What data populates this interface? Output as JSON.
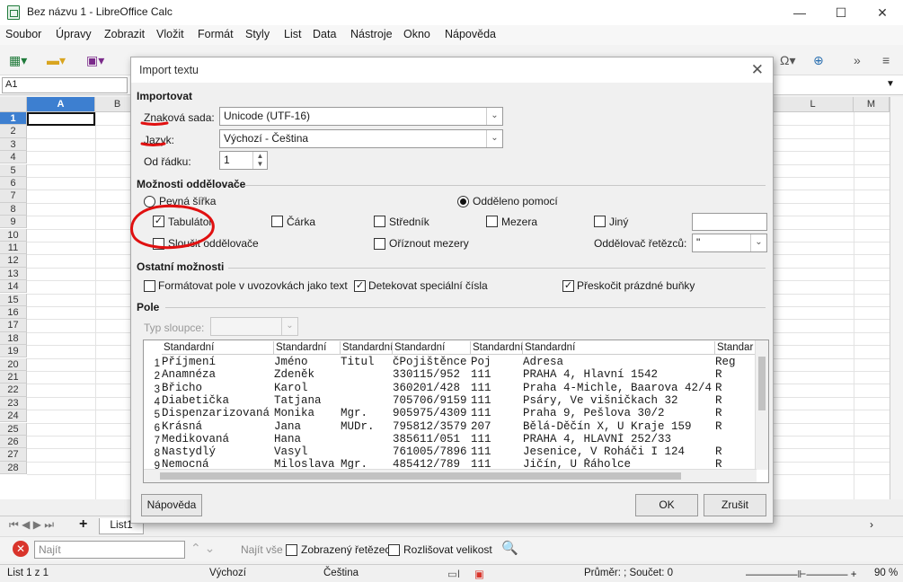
{
  "window": {
    "title": "Bez názvu 1 - LibreOffice Calc",
    "min": "—",
    "max": "☐",
    "close": "✕"
  },
  "menu": [
    "Soubor",
    "Úpravy",
    "Zobrazit",
    "Vložit",
    "Formát",
    "Styly",
    "List",
    "Data",
    "Nástroje",
    "Okno",
    "Nápověda"
  ],
  "formula": {
    "cell_ref": "A1"
  },
  "grid": {
    "columns": [
      "A",
      "B",
      "L",
      "M"
    ],
    "rows": [
      "1",
      "2",
      "3",
      "4",
      "5",
      "6",
      "7",
      "8",
      "9",
      "10",
      "11",
      "12",
      "13",
      "14",
      "15",
      "16",
      "17",
      "18",
      "19",
      "20",
      "21",
      "22",
      "23",
      "24",
      "25",
      "26",
      "27",
      "28"
    ]
  },
  "sheet": {
    "tab": "List1"
  },
  "find": {
    "placeholder": "Najít",
    "find_all": "Najít vše",
    "formatted": "Zobrazený řetězec",
    "match_case": "Rozlišovat velikost"
  },
  "status": {
    "sheet": "List 1 z 1",
    "style": "Výchozí",
    "lang": "Čeština",
    "sum": "Průměr: ; Součet: 0",
    "zoom": "90 %"
  },
  "dialog": {
    "title": "Import textu",
    "import_section": "Importovat",
    "charset_label": "Znaková sada:",
    "charset_value": "Unicode (UTF-16)",
    "lang_label": "Jazyk:",
    "lang_value": "Výchozí - Čeština",
    "row_label": "Od řádku:",
    "row_value": "1",
    "sep_section": "Možnosti oddělovače",
    "fixed_width": "Pevná šířka",
    "separated_by": "Odděleno pomocí",
    "tab": "Tabulátor",
    "comma": "Čárka",
    "semicolon": "Středník",
    "space": "Mezera",
    "other": "Jiný",
    "merge": "Sloučit oddělovače",
    "trim": "Oříznout mezery",
    "string_delim_label": "Oddělovač řetězců:",
    "string_delim_value": "\"",
    "other_section": "Ostatní možnosti",
    "quoted_as_text": "Formátovat pole v uvozovkách jako text",
    "detect_special": "Detekovat speciální čísla",
    "skip_empty": "Přeskočit prázdné buňky",
    "fields_section": "Pole",
    "col_type_label": "Typ sloupce:",
    "help": "Nápověda",
    "ok": "OK",
    "cancel": "Zrušit"
  },
  "preview": {
    "headers": [
      "Standardní",
      "Standardní",
      "Standardní",
      "Standardní",
      "Standardní",
      "Standardní",
      "Standar"
    ],
    "rows": [
      [
        "1",
        "Příjmení",
        "Jméno",
        "Titul",
        "čPojištěnce",
        "Poj",
        "Adresa",
        "Reg"
      ],
      [
        "2",
        "Anamnéza",
        "Zdeněk",
        "",
        "330115/952",
        "111",
        "PRAHA 4, Hlavní 1542",
        "R"
      ],
      [
        "3",
        "Břicho",
        "Karol",
        "",
        "360201/428",
        "111",
        "Praha 4-Michle, Baarova 42/4",
        "R"
      ],
      [
        "4",
        "Diabetička",
        "Tatjana",
        "",
        "705706/9159",
        "111",
        "Psáry, Ve višničkach 32",
        "R"
      ],
      [
        "5",
        "Dispenzarizovaná",
        "Monika",
        "Mgr.",
        "905975/4309",
        "111",
        "Praha 9, Pešlova 30/2",
        "R"
      ],
      [
        "6",
        "Krásná",
        "Jana",
        "MUDr.",
        "795812/3579",
        "207",
        "Bělá-Děčín X, U Kraje 159",
        "R"
      ],
      [
        "7",
        "Medikovaná",
        "Hana",
        "",
        "385611/051",
        "111",
        "PRAHA 4, HLAVNÍ 252/33",
        ""
      ],
      [
        "8",
        "Nastydlý",
        "Vasyl",
        "",
        "761005/7896",
        "111",
        "Jesenice, V Roháči I 124",
        "R"
      ],
      [
        "9",
        "Nemocná",
        "Miloslava",
        "Mgr.",
        "485412/789",
        "111",
        "Jičín, U Řáholce",
        "R"
      ]
    ]
  }
}
